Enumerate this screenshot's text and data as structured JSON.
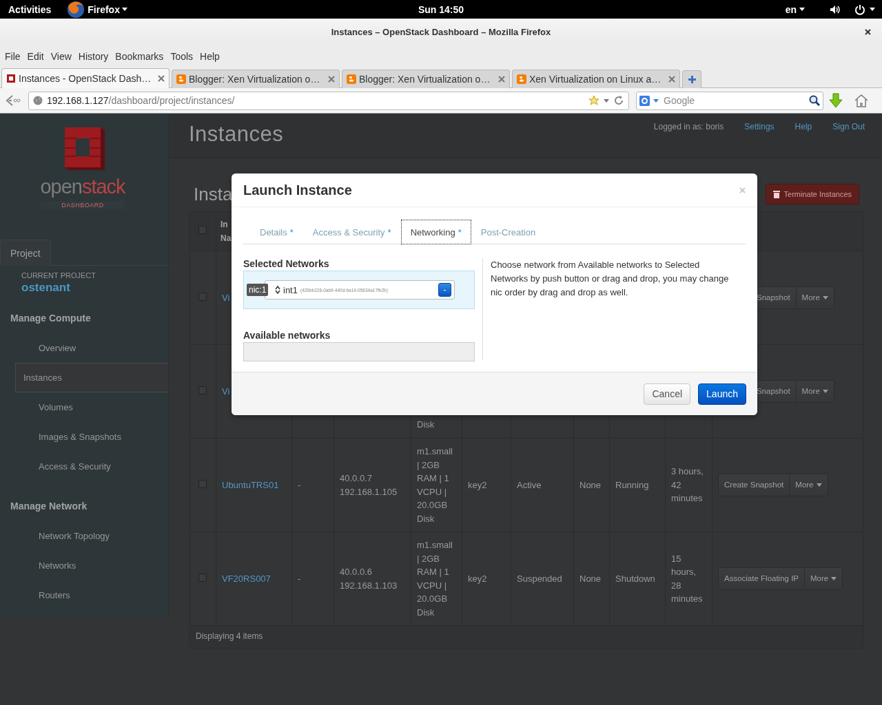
{
  "top_bar": {
    "activities": "Activities",
    "app_menu": "Firefox",
    "clock": "Sun 14:50",
    "keyboard_layout": "en"
  },
  "window": {
    "title": "Instances – OpenStack Dashboard – Mozilla Firefox"
  },
  "menu": [
    "File",
    "Edit",
    "View",
    "History",
    "Bookmarks",
    "Tools",
    "Help"
  ],
  "tabs": [
    {
      "label": "Instances - OpenStack Dash…",
      "selected": true,
      "kind": "openstack"
    },
    {
      "label": "Blogger: Xen Virtualization o…",
      "selected": false,
      "kind": "blogger"
    },
    {
      "label": "Blogger: Xen Virtualization o…",
      "selected": false,
      "kind": "blogger"
    },
    {
      "label": "Xen Virtualization on Linux a…",
      "selected": false,
      "kind": "blogger"
    }
  ],
  "address_bar": {
    "host": "192.168.1.127",
    "path": "/dashboard/project/instances/"
  },
  "search": {
    "placeholder": "Google"
  },
  "sidebar": {
    "logo": {
      "parts": [
        "open",
        "stack"
      ],
      "subtitle": "DASHBOARD"
    },
    "tabs": [
      {
        "label": "Project",
        "selected": true
      }
    ],
    "current_project_label": "CURRENT PROJECT",
    "current_project": "ostenant",
    "sections": [
      {
        "title": "Manage Compute",
        "items": [
          {
            "label": "Overview",
            "selected": false
          },
          {
            "label": "Instances",
            "selected": true
          },
          {
            "label": "Volumes",
            "selected": false
          },
          {
            "label": "Images & Snapshots",
            "selected": false
          },
          {
            "label": "Access & Security",
            "selected": false
          }
        ]
      },
      {
        "title": "Manage Network",
        "items": [
          {
            "label": "Network Topology",
            "selected": false
          },
          {
            "label": "Networks",
            "selected": false
          },
          {
            "label": "Routers",
            "selected": false
          }
        ]
      }
    ]
  },
  "header": {
    "title": "Instances",
    "logged_in": "Logged in as: boris",
    "links": [
      "Settings",
      "Help",
      "Sign Out"
    ]
  },
  "panel": {
    "title": "Insta",
    "terminate_button": "Terminate Instances"
  },
  "table": {
    "select_all_checked": false,
    "header": [
      "In",
      "Na"
    ],
    "rows": [
      {
        "kind": "covered",
        "checked": false,
        "name": "Vi",
        "actions": [
          "Snapshot",
          "More"
        ]
      },
      {
        "kind": "covered",
        "checked": false,
        "name": "Vi",
        "size": "Disk",
        "actions": [
          "Snapshot",
          "More"
        ]
      },
      {
        "kind": "full",
        "checked": false,
        "name": "UbuntuTRS01",
        "image": "-",
        "ips": [
          "40.0.0.7",
          "192.168.1.105"
        ],
        "size": "m1.small | 2GB RAM | 1 VCPU | 20.0GB Disk",
        "keypair": "key2",
        "status": "Active",
        "task": "None",
        "power": "Running",
        "uptime": "3 hours, 42 minutes",
        "actions": [
          "Create Snapshot",
          "More"
        ]
      },
      {
        "kind": "full",
        "checked": false,
        "name": "VF20RS007",
        "image": "-",
        "ips": [
          "40.0.0.6",
          "192.168.1.103"
        ],
        "size": "m1.small | 2GB RAM | 1 VCPU | 20.0GB Disk",
        "keypair": "key2",
        "status": "Suspended",
        "task": "None",
        "power": "Shutdown",
        "uptime": "15 hours, 28 minutes",
        "actions": [
          "Associate Floating IP",
          "More"
        ]
      }
    ],
    "footer": "Displaying 4 items"
  },
  "modal": {
    "title": "Launch Instance",
    "tabs": [
      {
        "label": "Details",
        "marker": "*",
        "selected": false
      },
      {
        "label": "Access & Security",
        "marker": "*",
        "selected": false
      },
      {
        "label": "Networking",
        "marker": "*",
        "selected": true
      },
      {
        "label": "Post-Creation",
        "selected": false
      }
    ],
    "selected_networks": {
      "title": "Selected Networks",
      "items": [
        {
          "badge": "nic:1",
          "name": "int1",
          "id": "(426bb226-0ab9-440d-ba14-05634a17fb2b)",
          "button": "-"
        }
      ]
    },
    "available_networks": {
      "title": "Available networks"
    },
    "help": "Choose network from Available networks to Selected Networks by push button or drag and drop, you may change nic order by drag and drop as well.",
    "buttons": [
      {
        "label": "Cancel",
        "kind": "secondary"
      },
      {
        "label": "Launch",
        "kind": "primary"
      }
    ]
  }
}
